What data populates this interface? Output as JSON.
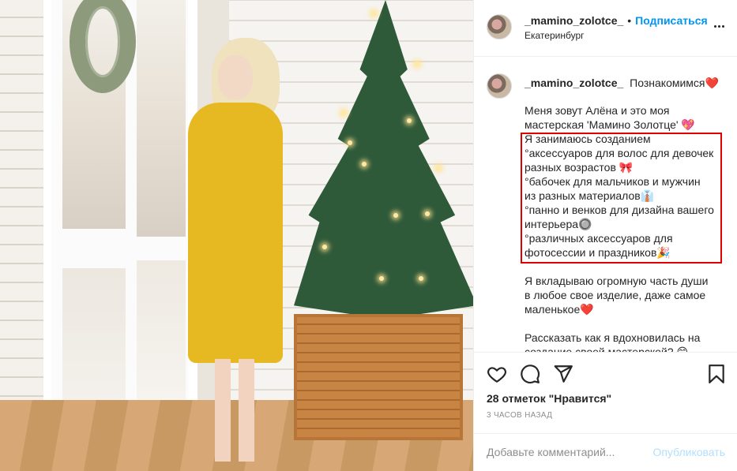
{
  "header": {
    "username": "_mamino_zolotce_",
    "separator": "•",
    "follow_label": "Подписаться",
    "location": "Екатеринбург"
  },
  "caption": {
    "username": "_mamino_zolotce_",
    "first_text": "Познакомимся❤️",
    "lines": [
      "",
      "Меня зовут Алёна и это моя",
      "мастерская 'Мамино Золотце' 💖",
      "Я занимаюсь созданием",
      "°аксессуаров для волос для девочек",
      "разных возрастов 🎀",
      "°бабочек для мальчиков и мужчин",
      "из разных материалов👔",
      "°панно и венков для дизайна вашего",
      "интерьера🔘",
      "°различных аксессуаров для",
      "фотосессии и праздников🎉",
      "",
      "Я вкладываю огромную часть души",
      "в любое свое изделие, даже самое",
      "маленькое❤️",
      "",
      "Рассказать как я вдохновилась на",
      "создание своей мастерской? 😊"
    ]
  },
  "actions": {
    "likes": "28 отметок \"Нравится\"",
    "time": "3 ЧАСОВ НАЗАД",
    "comment_placeholder": "Добавьте комментарий...",
    "publish_label": "Опубликовать"
  },
  "colors": {
    "link_blue": "#0095f6",
    "publish_disabled": "#b2dffc",
    "highlight_red": "#e00000"
  },
  "icons": [
    "heart-icon",
    "comment-icon",
    "share-icon",
    "bookmark-icon",
    "more-icon"
  ]
}
